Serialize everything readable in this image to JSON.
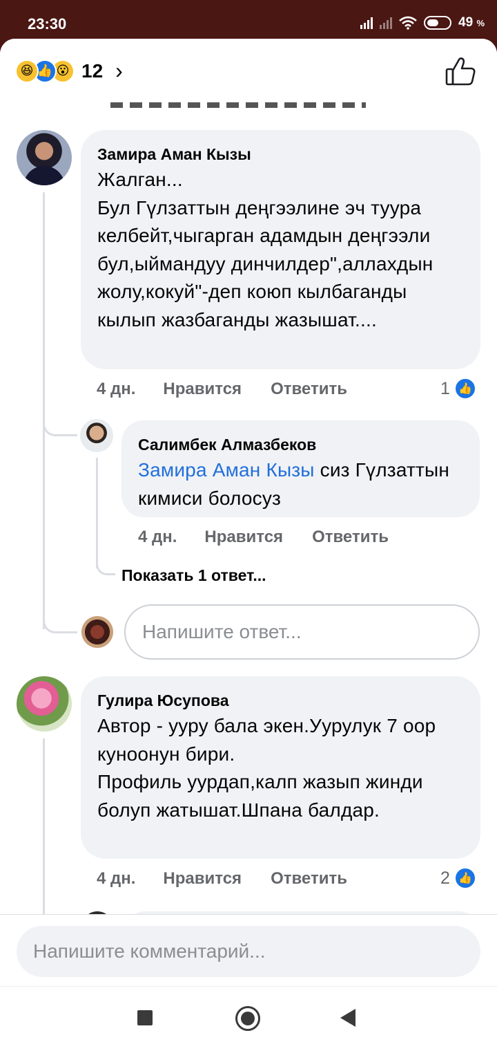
{
  "status_bar": {
    "time": "23:30",
    "battery_percent": "49",
    "battery_unit": "%"
  },
  "header": {
    "reaction_count": "12",
    "reactions": [
      "haha",
      "like",
      "wow"
    ]
  },
  "comments": [
    {
      "author": "Замира Аман Кызы",
      "text": "Жалган...\nБул Гүлзаттын деңгээлине эч туура келбейт,чыгарган адамдын деңгээли бул,ыймандуу динчилдер\",аллахдын жолу,кокуй\"-деп коюп кылбаганды кылып жазбаганды жазышат....",
      "time": "4 дн.",
      "like_label": "Нравится",
      "reply_label": "Ответить",
      "likes": "1",
      "replies": [
        {
          "author": "Салимбек Алмазбеков",
          "mention": "Замира Аман Кызы",
          "text_after_mention": " сиз Гүлзаттын кимиси болосуз",
          "time": "4 дн.",
          "like_label": "Нравится",
          "reply_label": "Ответить"
        }
      ],
      "show_replies_label": "Показать 1 ответ...",
      "reply_placeholder": "Напишите ответ..."
    },
    {
      "author": "Гулира Юсупова",
      "text": "Автор - ууру бала экен.Уурулук 7 оор куноонун бири.\nПрофиль уурдап,калп жазып жинди болуп жатышат.Шпана балдар.",
      "time": "4 дн.",
      "like_label": "Нравится",
      "reply_label": "Ответить",
      "likes": "2"
    }
  ],
  "composer": {
    "placeholder": "Напишите комментарий..."
  },
  "colors": {
    "status_bar": "#4a1713",
    "like_blue": "#1b74e4",
    "mention": "#216fdb",
    "bubble": "#f0f2f5"
  },
  "icons": [
    "signal-icon",
    "wifi-icon",
    "battery-icon",
    "chevron-right-icon",
    "thumbs-up-outline-icon",
    "recent-apps-icon",
    "home-icon",
    "back-icon"
  ]
}
